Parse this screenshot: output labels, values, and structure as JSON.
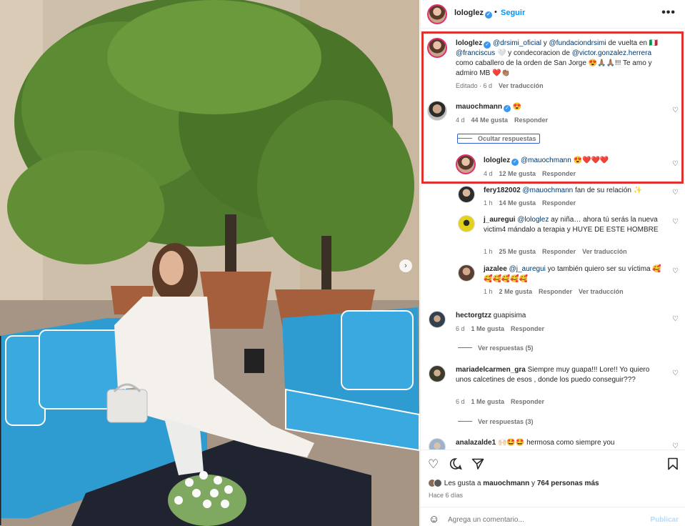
{
  "post": {
    "username": "lologlez",
    "dot": "•",
    "follow_label": "Seguir",
    "more_label": "•••",
    "carousel_next_icon": "chevron-right-icon"
  },
  "caption": {
    "username": "lologlez",
    "text_parts": [
      {
        "text": "@drsimi_oficial",
        "mention": true
      },
      {
        "text": " y ",
        "mention": false
      },
      {
        "text": "@fundaciondrsimi",
        "mention": true
      },
      {
        "text": " de vuelta en 🇮🇹 ",
        "mention": false
      },
      {
        "text": "@franciscus",
        "mention": true
      },
      {
        "text": " 🤍 y condecoracion de ",
        "mention": false
      },
      {
        "text": "@victor.gonzalez.herrera",
        "mention": true
      },
      {
        "text": " como caballero de la orden de San Jorge 😍🙏🏽🙏🏽!!! Te amo y admiro MB ❤️👏🏽",
        "mention": false
      }
    ],
    "edited": "Editado · 6 d",
    "translate": "Ver traducción"
  },
  "comments": [
    {
      "id": "mauochmann",
      "username": "mauochmann",
      "verified": true,
      "text": "😍",
      "time": "4 d",
      "likes": "44 Me gusta",
      "reply": "Responder",
      "translate": ""
    },
    {
      "id": "lologlez-reply",
      "username": "lologlez",
      "verified": true,
      "mention": "@mauochmann",
      "text": " 😍❤️❤️❤️",
      "time": "4 d",
      "likes": "12 Me gusta",
      "reply": "Responder",
      "translate": ""
    },
    {
      "id": "fery",
      "username": "fery182002",
      "mention": "@mauochmann",
      "text": " fan de su relación ✨",
      "time": "1 h",
      "likes": "14 Me gusta",
      "reply": "Responder",
      "translate": ""
    },
    {
      "id": "jauregui",
      "username": "j_auregui",
      "mention": "@lologlez",
      "text": " ay niña… ahora tú serás la nueva victim4 mándalo a terapia y HUYE DE ESTE HOMBRE",
      "time": "1 h",
      "likes": "25 Me gusta",
      "reply": "Responder",
      "translate": "Ver traducción"
    },
    {
      "id": "jazalee",
      "username": "jazalee",
      "mention": "@j_auregui",
      "text": " yo también quiero ser su víctima 🥰🥰🥰🥰🥰🥰",
      "time": "1 h",
      "likes": "2 Me gusta",
      "reply": "Responder",
      "translate": "Ver traducción"
    },
    {
      "id": "hector",
      "username": "hectorgtzz",
      "text": "guapisima",
      "time": "6 d",
      "likes": "1 Me gusta",
      "reply": "Responder",
      "translate": ""
    },
    {
      "id": "maria",
      "username": "mariadelcarmen_gra",
      "text": "Siempre muy guapa!!! Lore!! Yo quiero unos calcetines de esos , donde los puedo conseguir???",
      "time": "6 d",
      "likes": "1 Me gusta",
      "reply": "Responder",
      "translate": ""
    },
    {
      "id": "ana",
      "username": "analazalde1",
      "text": "🙌🏻🤩🤩 hermosa como siempre you"
    }
  ],
  "toggles": {
    "hide_replies": "Ocultar respuestas",
    "view_replies_hector": "Ver respuestas (5)",
    "view_replies_maria": "Ver respuestas (3)"
  },
  "actions": {
    "like_icon": "heart-icon",
    "comment_icon": "comment-icon",
    "share_icon": "send-icon",
    "save_icon": "bookmark-icon"
  },
  "likes": {
    "prefix": "Les gusta a ",
    "user": "mauochmann",
    "middle": " y ",
    "count": "764 personas más"
  },
  "date": "Hace 6 días",
  "add_comment": {
    "placeholder": "Agrega un comentario...",
    "publish": "Publicar",
    "emoji_icon": "smiley-icon"
  },
  "colors": {
    "link": "#0095f6",
    "highlight": "#e0322d",
    "mention": "#00376b",
    "verified": "#3897f0"
  }
}
